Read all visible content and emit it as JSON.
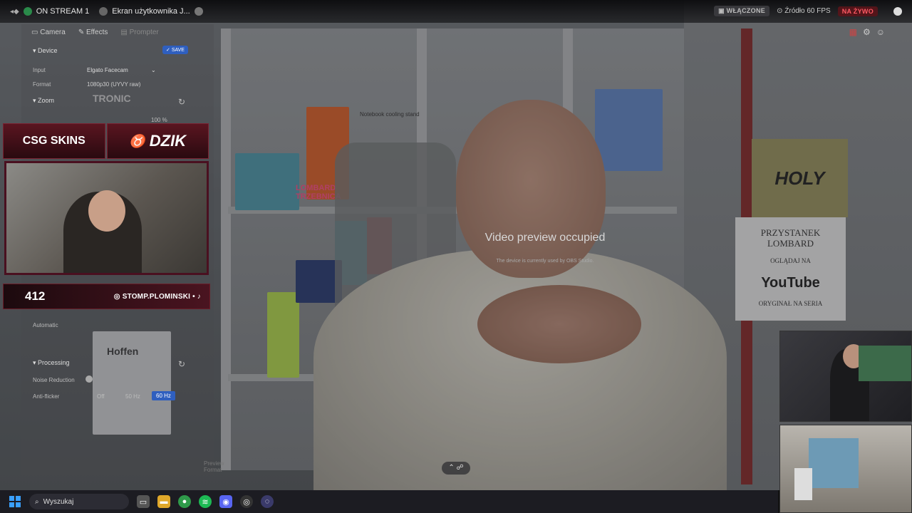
{
  "window": {
    "tab1_label": "ON STREAM 1",
    "tab2_label": "Ekran użytkownika J...",
    "status_enabled": "WŁĄCZONE",
    "status_source": "Źródło 60 FPS",
    "status_live": "NA ŻYWO"
  },
  "panel": {
    "tabs": [
      "Camera",
      "Effects",
      "Prompter"
    ],
    "device_section": "Device",
    "save_label": "SAVE",
    "input_label": "Input",
    "input_value": "Elgato Facecam",
    "format_label": "Format",
    "format_value": "1080p30 (UYVY raw)",
    "zoom_section": "Zoom",
    "zoom_value": "100 %",
    "automatic_label": "Automatic",
    "processing_section": "Processing",
    "noise_label": "Noise Reduction",
    "antiflicker_label": "Anti-flicker",
    "antiflicker_options": [
      "Off",
      "50 Hz",
      "60 Hz"
    ],
    "preview_format": "Preview Format"
  },
  "overlay": {
    "sponsor1": "CSG SKINS",
    "sponsor2": "DZIK",
    "counter": "412",
    "handle": "STOMP.PLOMINSKI"
  },
  "scene": {
    "holy_sign": "HOLY",
    "paper_line1": "PRZYSTANEK",
    "paper_line2": "LOMBARD",
    "paper_line3": "OGLĄDAJ NA",
    "paper_youtube": "YouTube",
    "paper_line4": "ORYGINAŁ NA SERIA",
    "lombard_neon": "LOMBARD TRZEBNICA",
    "hoffen": "Hoffen",
    "tronic": "TRONIC",
    "notebook": "Notebook cooling stand"
  },
  "preview": {
    "occupied_title": "Video preview occupied",
    "occupied_sub": "The device is currently used by OBS Studio."
  },
  "taskbar": {
    "search_placeholder": "Wyszukaj"
  },
  "colors": {
    "live_red": "#ff5a64",
    "accent_blue": "#2f5fbf",
    "overlay_maroon": "#4a1420"
  }
}
